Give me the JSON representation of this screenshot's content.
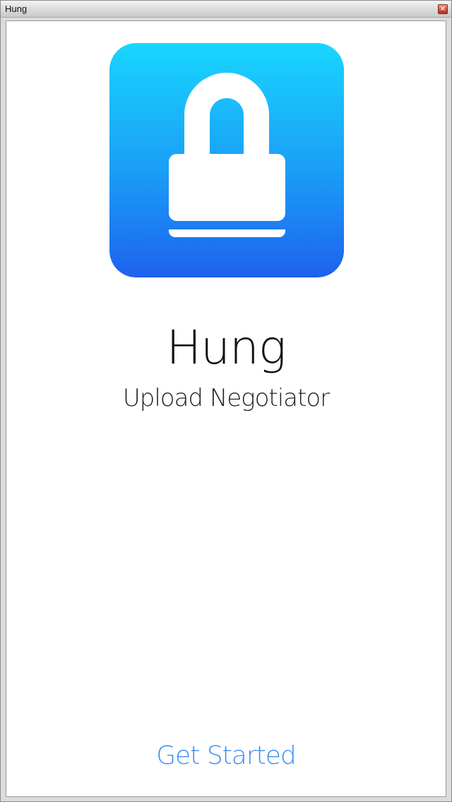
{
  "window": {
    "title": "Hung",
    "close_icon": "close-icon",
    "close_symbol": "×"
  },
  "app": {
    "icon": "lock-icon",
    "name": "Hung",
    "subtitle": "Upload Negotiator",
    "cta_label": "Get Started"
  },
  "colors": {
    "icon_gradient_top": "#19d6ff",
    "icon_gradient_bottom": "#1e62ee",
    "cta_text": "#3a8ff5"
  }
}
